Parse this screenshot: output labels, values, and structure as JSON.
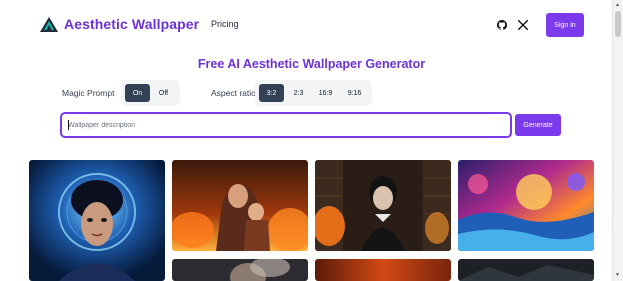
{
  "header": {
    "brand": "Aesthetic Wallpaper",
    "nav_pricing": "Pricing",
    "signin_label": "Sign in",
    "icons": [
      "github-icon",
      "x-icon"
    ]
  },
  "title": "Free AI Aesthetic Wallpaper Generator",
  "magic_prompt": {
    "label": "Magic Prompt",
    "options": [
      "On",
      "Off"
    ],
    "selected": "On"
  },
  "aspect_ratio": {
    "label": "Aspect ratio",
    "options": [
      "3:2",
      "2:3",
      "16:9",
      "9:16"
    ],
    "selected": "3:2"
  },
  "search": {
    "placeholder": "Wallpaper description",
    "value": ""
  },
  "generate_label": "Generate",
  "colors": {
    "accent": "#7c3aed",
    "brand_text": "#6d33d6",
    "segment_active": "#334155"
  },
  "gallery": [
    "blue-glowing-portrait",
    "mother-and-child-in-fire",
    "girl-in-library-with-fire",
    "fantasy-neon-landscape",
    "portrait-in-shadows",
    "elderly-portrait",
    "orange-fire-scene",
    "dark-landscape"
  ]
}
